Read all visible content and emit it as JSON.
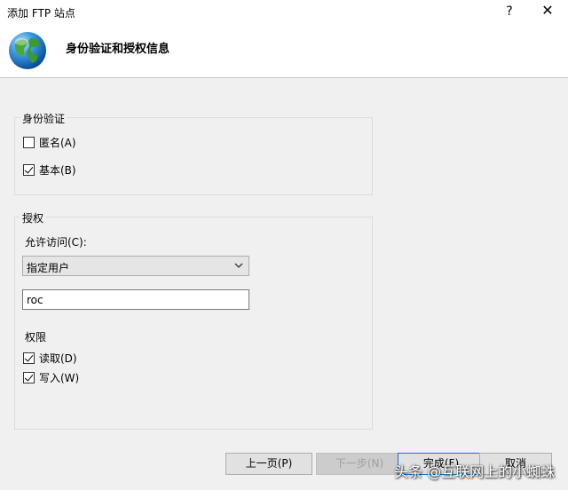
{
  "window": {
    "title": "添加 FTP 站点",
    "help": "?",
    "close": "✕"
  },
  "header": {
    "title": "身份验证和授权信息"
  },
  "auth": {
    "group_label": "身份验证",
    "anonymous": {
      "label": "匿名(A)",
      "checked": false
    },
    "basic": {
      "label": "基本(B)",
      "checked": true
    }
  },
  "authorization": {
    "group_label": "授权",
    "allow_access_label": "允许访问(C):",
    "allow_access_value": "指定用户",
    "user_value": "roc",
    "permissions_label": "权限",
    "read": {
      "label": "读取(D)",
      "checked": true
    },
    "write": {
      "label": "写入(W)",
      "checked": true
    }
  },
  "footer": {
    "prev": "上一页(P)",
    "next": "下一步(N)",
    "finish": "完成(F)",
    "cancel": "取消"
  },
  "watermark": "头条 @互联网上的小蜘蛛"
}
